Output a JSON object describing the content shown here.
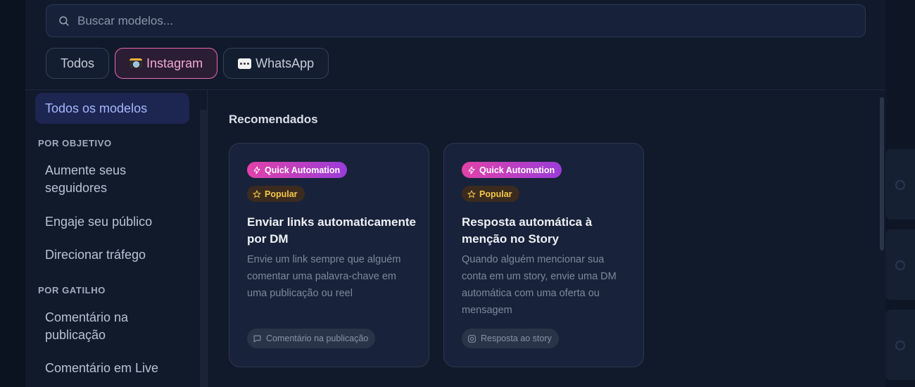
{
  "search": {
    "placeholder": "Buscar modelos..."
  },
  "filters": [
    {
      "label": "Todos",
      "icon": "",
      "active": false
    },
    {
      "label": "Instagram",
      "icon": "camera-emoji",
      "active": true
    },
    {
      "label": "WhatsApp",
      "icon": "speech-balloon-emoji",
      "active": false
    }
  ],
  "sidebar": {
    "all_models": "Todos os modelos",
    "objective_header": "POR OBJETIVO",
    "objective_items": [
      "Aumente seus seguidores",
      "Engaje seu público",
      "Direcionar tráfego"
    ],
    "trigger_header": "POR GATILHO",
    "trigger_items": [
      "Comentário na publicação",
      "Comentário em Live"
    ]
  },
  "main": {
    "section_title": "Recomendados",
    "cards": [
      {
        "badge_automation": "Quick Automation",
        "badge_popular": "Popular",
        "title": "Enviar links automaticamente por DM",
        "description": "Envie um link sempre que alguém comentar uma palavra-chave em uma publicação ou reel",
        "tag": "Comentário na publicação",
        "tag_icon": "comment-icon"
      },
      {
        "badge_automation": "Quick Automation",
        "badge_popular": "Popular",
        "title": "Resposta automática à menção no Story",
        "description": "Quando alguém mencionar sua conta em um story, envie uma DM automática com uma oferta ou mensagem",
        "tag": "Resposta ao story",
        "tag_icon": "instagram-icon"
      }
    ]
  },
  "colors": {
    "accent_pink": "#ea6bb4",
    "badge_gradient_start": "#e142a8",
    "badge_gradient_end": "#9a3cd9",
    "popular_text": "#f5c84a",
    "active_sidebar_bg": "#1c2650"
  }
}
